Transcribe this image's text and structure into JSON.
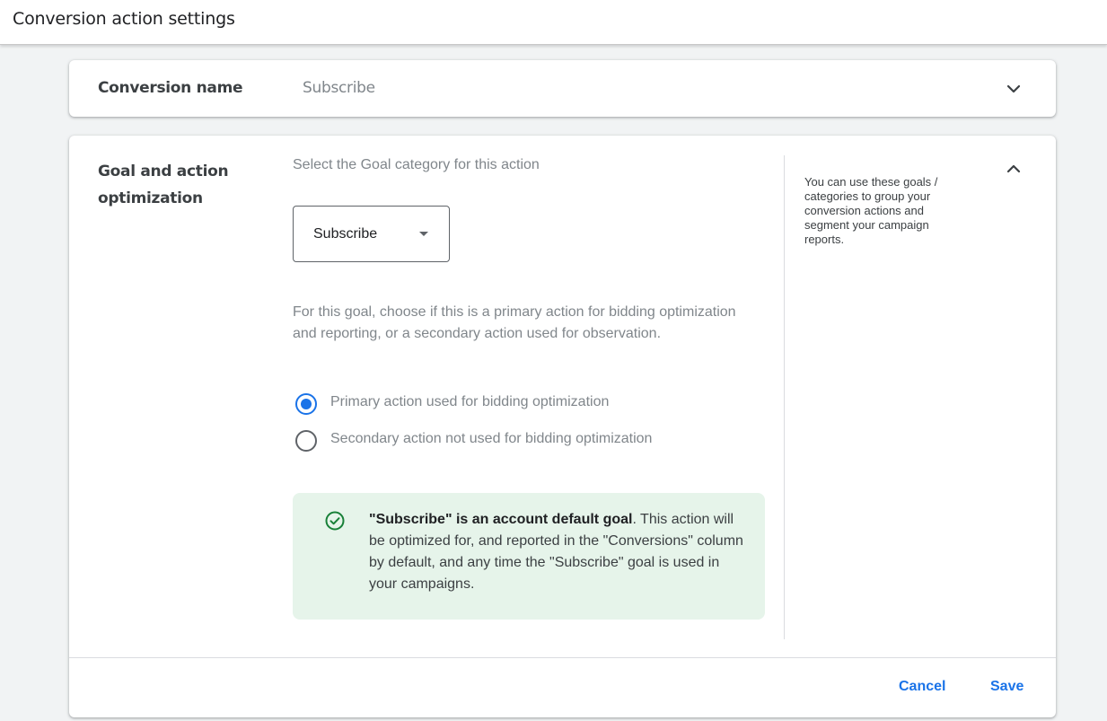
{
  "header": {
    "title": "Conversion action settings"
  },
  "conversion_name": {
    "label": "Conversion name",
    "value": "Subscribe",
    "expand_icon": "chevron-down-icon"
  },
  "goal_section": {
    "label": "Goal and action optimization",
    "collapse_icon": "chevron-up-icon",
    "select_prompt": "Select the Goal category for this action",
    "goal_dropdown": {
      "selected": "Subscribe"
    },
    "description": "For this goal, choose if this is a primary action for bidding optimization and reporting, or a secondary action used for observation.",
    "options": [
      {
        "label": "Primary action used for bidding optimization",
        "checked": true
      },
      {
        "label": "Secondary action not used for bidding optimization",
        "checked": false
      }
    ],
    "info": {
      "icon": "check-circle-icon",
      "bold": "\"Subscribe\" is an account default goal",
      "rest": ". This action will be optimized for, and reported in the \"Conversions\" column by default, and any time the \"Subscribe\" goal is used in your campaigns."
    },
    "help_text": "You can use these goals / categories to group your conversion actions and segment your campaign reports."
  },
  "footer": {
    "cancel_label": "Cancel",
    "save_label": "Save"
  },
  "colors": {
    "accent": "#1a73e8",
    "success_bg": "#e6f4ea",
    "success_icon": "#188038"
  }
}
